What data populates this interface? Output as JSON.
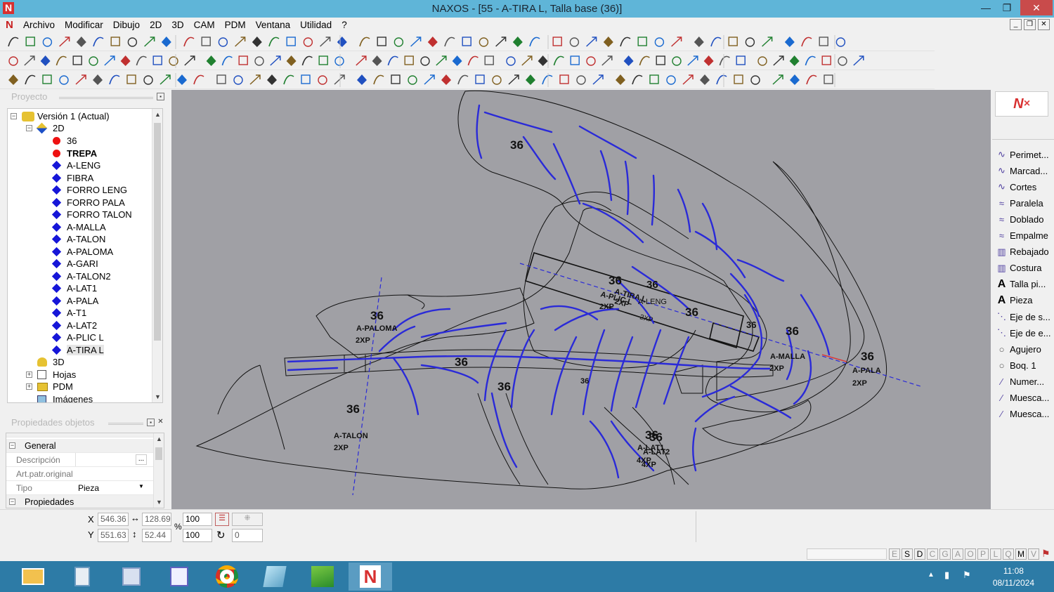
{
  "window": {
    "title": "NAXOS - [55 - A-TIRA L, Talla base (36)]",
    "logo_letter": "N",
    "minimize": "—",
    "restore": "❐",
    "close": "✕"
  },
  "menu": {
    "items": [
      "Archivo",
      "Modificar",
      "Dibujo",
      "2D",
      "3D",
      "CAM",
      "PDM",
      "Ventana",
      "Utilidad",
      "?"
    ]
  },
  "project_panel": {
    "title": "Proyecto",
    "root": "Versión 1 (Actual)",
    "node_2d": "2D",
    "layers": [
      {
        "label": "36",
        "marker": "red-dot",
        "bold": false
      },
      {
        "label": "TREPA",
        "marker": "red-dot",
        "bold": true
      },
      {
        "label": "A-LENG",
        "marker": "blue-diamond",
        "bold": false
      },
      {
        "label": "FIBRA",
        "marker": "blue-diamond",
        "bold": false
      },
      {
        "label": "FORRO LENG",
        "marker": "blue-diamond",
        "bold": false
      },
      {
        "label": "FORRO PALA",
        "marker": "blue-diamond",
        "bold": false
      },
      {
        "label": "FORRO TALON",
        "marker": "blue-diamond",
        "bold": false
      },
      {
        "label": "A-MALLA",
        "marker": "blue-diamond",
        "bold": false
      },
      {
        "label": "A-TALON",
        "marker": "blue-diamond",
        "bold": false
      },
      {
        "label": "A-PALOMA",
        "marker": "blue-diamond",
        "bold": false
      },
      {
        "label": "A-GARI",
        "marker": "blue-diamond",
        "bold": false
      },
      {
        "label": "A-TALON2",
        "marker": "blue-diamond",
        "bold": false
      },
      {
        "label": "A-LAT1",
        "marker": "blue-diamond",
        "bold": false
      },
      {
        "label": "A-PALA",
        "marker": "blue-diamond",
        "bold": false
      },
      {
        "label": "A-T1",
        "marker": "blue-diamond",
        "bold": false
      },
      {
        "label": "A-LAT2",
        "marker": "blue-diamond",
        "bold": false
      },
      {
        "label": "A-PLIC L",
        "marker": "blue-diamond",
        "bold": false
      },
      {
        "label": "A-TIRA L",
        "marker": "blue-diamond",
        "bold": false
      }
    ],
    "node_3d": "3D",
    "node_hojas": "Hojas",
    "node_pdm": "PDM",
    "node_imagenes": "Imágenes"
  },
  "properties_panel": {
    "title": "Propiedades objetos",
    "section_general": "General",
    "label_descripcion": "Descripción",
    "label_art": "Art.patr.original",
    "label_tipo": "Tipo",
    "value_tipo": "Pieza",
    "section_propiedades": "Propiedades"
  },
  "right_panel": {
    "items": [
      {
        "label": "Perimet...",
        "icon": "curve-icon"
      },
      {
        "label": "Marcad...",
        "icon": "curve-icon"
      },
      {
        "label": "Cortes",
        "icon": "curve-icon"
      },
      {
        "label": "Paralela",
        "icon": "double-curve-icon"
      },
      {
        "label": "Doblado",
        "icon": "double-curve-icon"
      },
      {
        "label": "Empalme",
        "icon": "double-curve-icon"
      },
      {
        "label": "Rebajado",
        "icon": "bars-icon"
      },
      {
        "label": "Costura",
        "icon": "bars-icon"
      },
      {
        "label": "Talla pi...",
        "icon": "letter-a-icon"
      },
      {
        "label": "Pieza",
        "icon": "letter-a-icon"
      },
      {
        "label": "Eje de s...",
        "icon": "dashed-line-icon"
      },
      {
        "label": "Eje de e...",
        "icon": "dashed-line-icon"
      },
      {
        "label": "Agujero",
        "icon": "circle-icon"
      },
      {
        "label": "Boq. 1",
        "icon": "circle-icon"
      },
      {
        "label": "Numer...",
        "icon": "pen-icon"
      },
      {
        "label": "Muesca...",
        "icon": "pen-icon"
      },
      {
        "label": "Muesca...",
        "icon": "pen-icon"
      }
    ]
  },
  "canvas": {
    "size_labels": [
      "36",
      "36",
      "36",
      "36",
      "36",
      "36",
      "36",
      "36",
      "36",
      "36",
      "36",
      "36",
      "36",
      "36",
      "36"
    ],
    "piece_labels": {
      "paloma": "A-PALOMA",
      "talon": "A-TALON",
      "malla": "A-MALLA",
      "pala": "A-PALA",
      "lat1": "A-LAT1",
      "lat2": "A-LAT2",
      "plic": "A-PLIC L",
      "tira": "A-TIRA L",
      "leng": "A-LENG"
    },
    "qty_labels": {
      "two": "2XP",
      "four": "4XP"
    }
  },
  "coords": {
    "x_label": "X",
    "y_label": "Y",
    "x": "546.36",
    "y": "551.63",
    "width": "128.69",
    "height": "52.44",
    "scale_x": "100",
    "scale_y": "100",
    "percent": "%",
    "rotation": "0"
  },
  "status": {
    "letters": [
      "E",
      "S",
      "D",
      "C",
      "G",
      "A",
      "O",
      "P",
      "L",
      "Q",
      "M",
      "V"
    ]
  },
  "taskbar": {
    "time": "11:08",
    "date": "08/11/2024"
  },
  "colors": {
    "canvas_bg": "#a0a0a5",
    "blue_line": "#2a2ad8",
    "titlebar": "#5fb5d8",
    "taskbar": "#2d7ba6"
  }
}
